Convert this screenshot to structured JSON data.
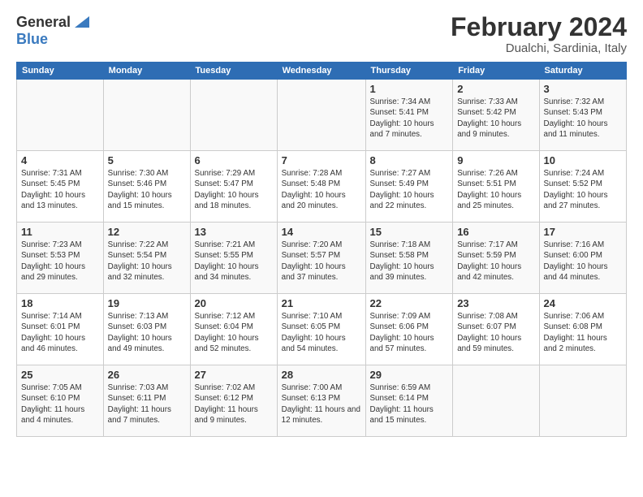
{
  "logo": {
    "general": "General",
    "blue": "Blue"
  },
  "title": {
    "month_year": "February 2024",
    "location": "Dualchi, Sardinia, Italy"
  },
  "weekdays": [
    "Sunday",
    "Monday",
    "Tuesday",
    "Wednesday",
    "Thursday",
    "Friday",
    "Saturday"
  ],
  "weeks": [
    [
      {
        "day": "",
        "info": ""
      },
      {
        "day": "",
        "info": ""
      },
      {
        "day": "",
        "info": ""
      },
      {
        "day": "",
        "info": ""
      },
      {
        "day": "1",
        "info": "Sunrise: 7:34 AM\nSunset: 5:41 PM\nDaylight: 10 hours\nand 7 minutes."
      },
      {
        "day": "2",
        "info": "Sunrise: 7:33 AM\nSunset: 5:42 PM\nDaylight: 10 hours\nand 9 minutes."
      },
      {
        "day": "3",
        "info": "Sunrise: 7:32 AM\nSunset: 5:43 PM\nDaylight: 10 hours\nand 11 minutes."
      }
    ],
    [
      {
        "day": "4",
        "info": "Sunrise: 7:31 AM\nSunset: 5:45 PM\nDaylight: 10 hours\nand 13 minutes."
      },
      {
        "day": "5",
        "info": "Sunrise: 7:30 AM\nSunset: 5:46 PM\nDaylight: 10 hours\nand 15 minutes."
      },
      {
        "day": "6",
        "info": "Sunrise: 7:29 AM\nSunset: 5:47 PM\nDaylight: 10 hours\nand 18 minutes."
      },
      {
        "day": "7",
        "info": "Sunrise: 7:28 AM\nSunset: 5:48 PM\nDaylight: 10 hours\nand 20 minutes."
      },
      {
        "day": "8",
        "info": "Sunrise: 7:27 AM\nSunset: 5:49 PM\nDaylight: 10 hours\nand 22 minutes."
      },
      {
        "day": "9",
        "info": "Sunrise: 7:26 AM\nSunset: 5:51 PM\nDaylight: 10 hours\nand 25 minutes."
      },
      {
        "day": "10",
        "info": "Sunrise: 7:24 AM\nSunset: 5:52 PM\nDaylight: 10 hours\nand 27 minutes."
      }
    ],
    [
      {
        "day": "11",
        "info": "Sunrise: 7:23 AM\nSunset: 5:53 PM\nDaylight: 10 hours\nand 29 minutes."
      },
      {
        "day": "12",
        "info": "Sunrise: 7:22 AM\nSunset: 5:54 PM\nDaylight: 10 hours\nand 32 minutes."
      },
      {
        "day": "13",
        "info": "Sunrise: 7:21 AM\nSunset: 5:55 PM\nDaylight: 10 hours\nand 34 minutes."
      },
      {
        "day": "14",
        "info": "Sunrise: 7:20 AM\nSunset: 5:57 PM\nDaylight: 10 hours\nand 37 minutes."
      },
      {
        "day": "15",
        "info": "Sunrise: 7:18 AM\nSunset: 5:58 PM\nDaylight: 10 hours\nand 39 minutes."
      },
      {
        "day": "16",
        "info": "Sunrise: 7:17 AM\nSunset: 5:59 PM\nDaylight: 10 hours\nand 42 minutes."
      },
      {
        "day": "17",
        "info": "Sunrise: 7:16 AM\nSunset: 6:00 PM\nDaylight: 10 hours\nand 44 minutes."
      }
    ],
    [
      {
        "day": "18",
        "info": "Sunrise: 7:14 AM\nSunset: 6:01 PM\nDaylight: 10 hours\nand 46 minutes."
      },
      {
        "day": "19",
        "info": "Sunrise: 7:13 AM\nSunset: 6:03 PM\nDaylight: 10 hours\nand 49 minutes."
      },
      {
        "day": "20",
        "info": "Sunrise: 7:12 AM\nSunset: 6:04 PM\nDaylight: 10 hours\nand 52 minutes."
      },
      {
        "day": "21",
        "info": "Sunrise: 7:10 AM\nSunset: 6:05 PM\nDaylight: 10 hours\nand 54 minutes."
      },
      {
        "day": "22",
        "info": "Sunrise: 7:09 AM\nSunset: 6:06 PM\nDaylight: 10 hours\nand 57 minutes."
      },
      {
        "day": "23",
        "info": "Sunrise: 7:08 AM\nSunset: 6:07 PM\nDaylight: 10 hours\nand 59 minutes."
      },
      {
        "day": "24",
        "info": "Sunrise: 7:06 AM\nSunset: 6:08 PM\nDaylight: 11 hours\nand 2 minutes."
      }
    ],
    [
      {
        "day": "25",
        "info": "Sunrise: 7:05 AM\nSunset: 6:10 PM\nDaylight: 11 hours\nand 4 minutes."
      },
      {
        "day": "26",
        "info": "Sunrise: 7:03 AM\nSunset: 6:11 PM\nDaylight: 11 hours\nand 7 minutes."
      },
      {
        "day": "27",
        "info": "Sunrise: 7:02 AM\nSunset: 6:12 PM\nDaylight: 11 hours\nand 9 minutes."
      },
      {
        "day": "28",
        "info": "Sunrise: 7:00 AM\nSunset: 6:13 PM\nDaylight: 11 hours\nand 12 minutes."
      },
      {
        "day": "29",
        "info": "Sunrise: 6:59 AM\nSunset: 6:14 PM\nDaylight: 11 hours\nand 15 minutes."
      },
      {
        "day": "",
        "info": ""
      },
      {
        "day": "",
        "info": ""
      }
    ]
  ]
}
